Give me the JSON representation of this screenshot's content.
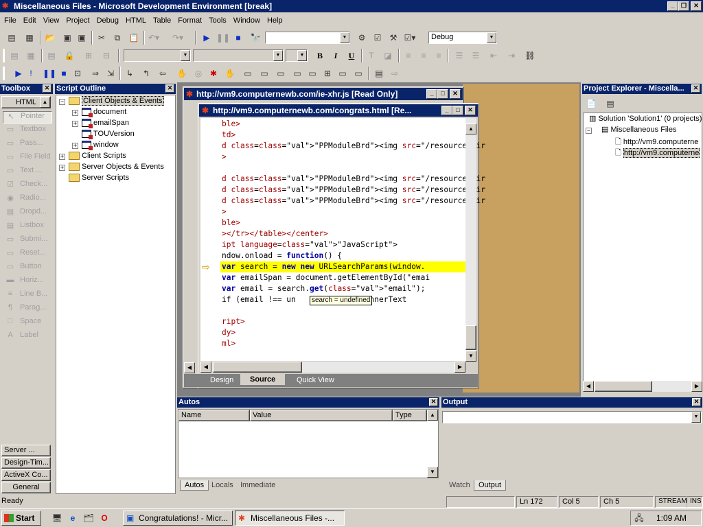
{
  "window": {
    "title": "Miscellaneous Files - Microsoft Development Environment [break]"
  },
  "menu": [
    "File",
    "Edit",
    "View",
    "Project",
    "Debug",
    "HTML",
    "Table",
    "Format",
    "Tools",
    "Window",
    "Help"
  ],
  "toolbar": {
    "config": "Debug"
  },
  "toolbox": {
    "title": "Toolbox",
    "tab": "HTML",
    "items": [
      "Pointer",
      "Textbox",
      "Pass...",
      "File Field",
      "Text ...",
      "Check...",
      "Radio...",
      "Dropd...",
      "Listbox",
      "Submi...",
      "Reset...",
      "Button",
      "Horiz...",
      "Line B...",
      "Parag...",
      "Space",
      "Label"
    ],
    "bottom_tabs": [
      "Server ...",
      "Design-Tim...",
      "ActiveX Co...",
      "General"
    ]
  },
  "outline": {
    "title": "Script Outline",
    "nodes": [
      "Client Objects & Events",
      "document",
      "emailSpan",
      "TOUVersion",
      "window",
      "Client Scripts",
      "Server Objects & Events",
      "Server Scripts"
    ]
  },
  "doc_back": {
    "title": "http://vm9.computernewb.com/ie-xhr.js [Read Only]"
  },
  "doc_front": {
    "title": "http://vm9.computernewb.com/congrats.html [Re...",
    "tabs": [
      "Design",
      "Source",
      "Quick View"
    ],
    "tooltip": "search = undefined"
  },
  "code_lines": [
    "ble>",
    "td>",
    "d class=\"PPModuleBrd\"><img src=\"/resources/ir",
    ">",
    "",
    "d class=\"PPModuleBrd\"><img src=\"/resources/ir",
    "d class=\"PPModuleBrd\"><img src=\"/resources/ir",
    "d class=\"PPModuleBrd\"><img src=\"/resources/ir",
    ">",
    "ble>",
    "></tr></table></center>",
    "ipt language=\"JavaScript\">",
    "ndow.onload = function() {",
    "var search = new new URLSearchParams(window.",
    "var emailSpan = document.getElementById(\"emai",
    "var email = search.get(\"email\");",
    "if (email !== un        ilSpan.innerText",
    "",
    "ript>",
    "dy>",
    "ml>"
  ],
  "project": {
    "title": "Project Explorer - Miscella...",
    "solution": "Solution 'Solution1' (0 projects)",
    "folder": "Miscellaneous Files",
    "files": [
      "http://vm9.computerne",
      "http://vm9.computerne"
    ]
  },
  "autos": {
    "title": "Autos",
    "columns": [
      "Name",
      "Value",
      "Type"
    ],
    "tabs": [
      "Autos",
      "Locals",
      "Immediate"
    ]
  },
  "output": {
    "title": "Output",
    "tabs": [
      "Watch",
      "Output"
    ]
  },
  "status": {
    "text": "Ready",
    "ln": "Ln 172",
    "col": "Col 5",
    "ch": "Ch 5",
    "mode1": "STREAM",
    "mode2": "INS"
  },
  "taskbar": {
    "start": "Start",
    "tasks": [
      "Congratulations! - Micr...",
      "Miscellaneous Files -..."
    ],
    "clock": "1:09 AM"
  }
}
